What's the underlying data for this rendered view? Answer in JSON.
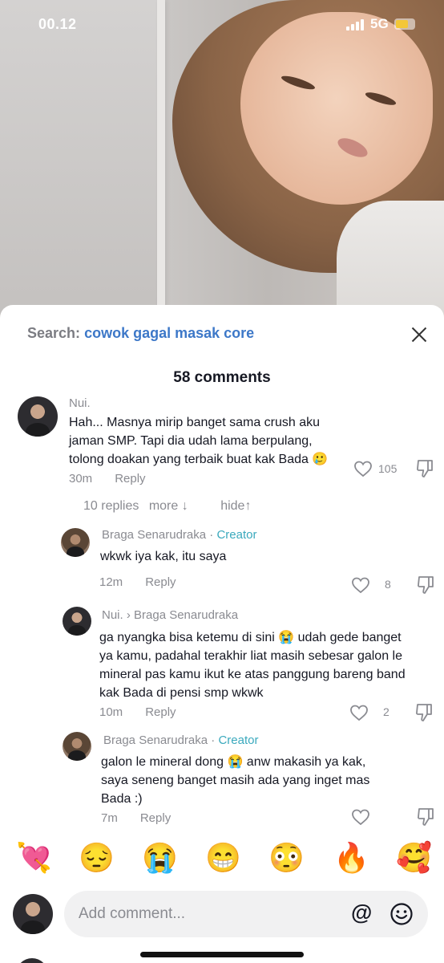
{
  "status_bar": {
    "time": "00.12",
    "network": "5G",
    "battery_level": 0.7
  },
  "search": {
    "prefix": "Search:",
    "term": "cowok gagal masak core"
  },
  "comments_header": {
    "count_label": "58 comments"
  },
  "comments": [
    {
      "username": "Nui.",
      "text": "Hah... Masnya mirip banget sama crush aku jaman SMP. Tapi dia udah lama berpulang, tolong doakan yang terbaik buat kak Bada 🥲",
      "time": "30m",
      "reply_label": "Reply",
      "likes": "105"
    }
  ],
  "replies_row": {
    "label": "10 replies",
    "more": "more ↓",
    "hide": "hide↑"
  },
  "replies": [
    {
      "username": "Braga Senarudraka",
      "separator": " · ",
      "creator_label": "Creator",
      "text": "wkwk iya kak, itu saya",
      "time": "12m",
      "reply_label": "Reply",
      "likes": "8"
    },
    {
      "username": "Nui. › Braga Senarudraka",
      "text": "ga nyangka bisa ketemu di sini 😭 udah gede banget ya kamu, padahal terakhir liat masih sebesar galon le mineral pas kamu ikut ke atas panggung bareng band kak Bada di pensi smp wkwk",
      "time": "10m",
      "reply_label": "Reply",
      "likes": "2"
    },
    {
      "username": "Braga Senarudraka",
      "separator": " · ",
      "creator_label": "Creator",
      "text": "galon le mineral dong 😭 anw makasih ya kak, saya seneng banget masih ada yang inget mas Bada :)",
      "time": "7m",
      "reply_label": "Reply"
    }
  ],
  "emoji_bar": [
    "💘",
    "😔",
    "😭",
    "😁",
    "😳",
    "🔥",
    "🥰"
  ],
  "input": {
    "placeholder": "Add comment...",
    "mention_symbol": "@"
  },
  "icons": {
    "close": "close-icon",
    "like": "heart-outline-icon",
    "dislike": "thumbs-down-icon",
    "emoji_picker": "smiley-icon"
  }
}
